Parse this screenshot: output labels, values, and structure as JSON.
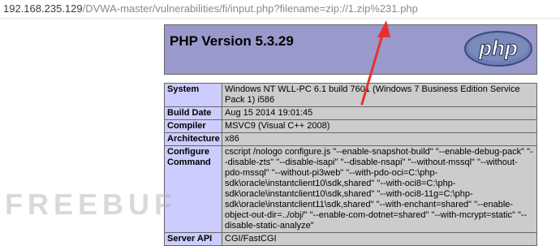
{
  "browser": {
    "url_host": "192.168.235.129",
    "url_path": "/DVWA-master/vulnerabilities/fi/input.php?filename=zip://1.zip%231.php"
  },
  "php": {
    "title": "PHP Version 5.3.29",
    "logo_text": "php"
  },
  "info_rows": [
    {
      "label": "System",
      "value": "Windows NT WLL-PC 6.1 build 7601 (Windows 7 Business Edition Service Pack 1) i586"
    },
    {
      "label": "Build Date",
      "value": "Aug 15 2014 19:01:45"
    },
    {
      "label": "Compiler",
      "value": "MSVC9 (Visual C++ 2008)"
    },
    {
      "label": "Architecture",
      "value": "x86"
    },
    {
      "label": "Configure Command",
      "value": "cscript /nologo configure.js \"--enable-snapshot-build\" \"--enable-debug-pack\" \"--disable-zts\" \"--disable-isapi\" \"--disable-nsapi\" \"--without-mssql\" \"--without-pdo-mssql\" \"--without-pi3web\" \"--with-pdo-oci=C:\\php-sdk\\oracle\\instantclient10\\sdk,shared\" \"--with-oci8=C:\\php-sdk\\oracle\\instantclient10\\sdk,shared\" \"--with-oci8-11g=C:\\php-sdk\\oracle\\instantclient11\\sdk,shared\" \"--with-enchant=shared\" \"--enable-object-out-dir=../obj/\" \"--enable-com-dotnet=shared\" \"--with-mcrypt=static\" \"--disable-static-analyze\""
    },
    {
      "label": "Server API",
      "value": "CGI/FastCGI"
    }
  ],
  "watermark": {
    "text": "FREEBUF"
  },
  "colors": {
    "header_bg": "#9999cc",
    "label_bg": "#ccccff",
    "value_bg": "#cccccc",
    "arrow": "#e8312a"
  }
}
